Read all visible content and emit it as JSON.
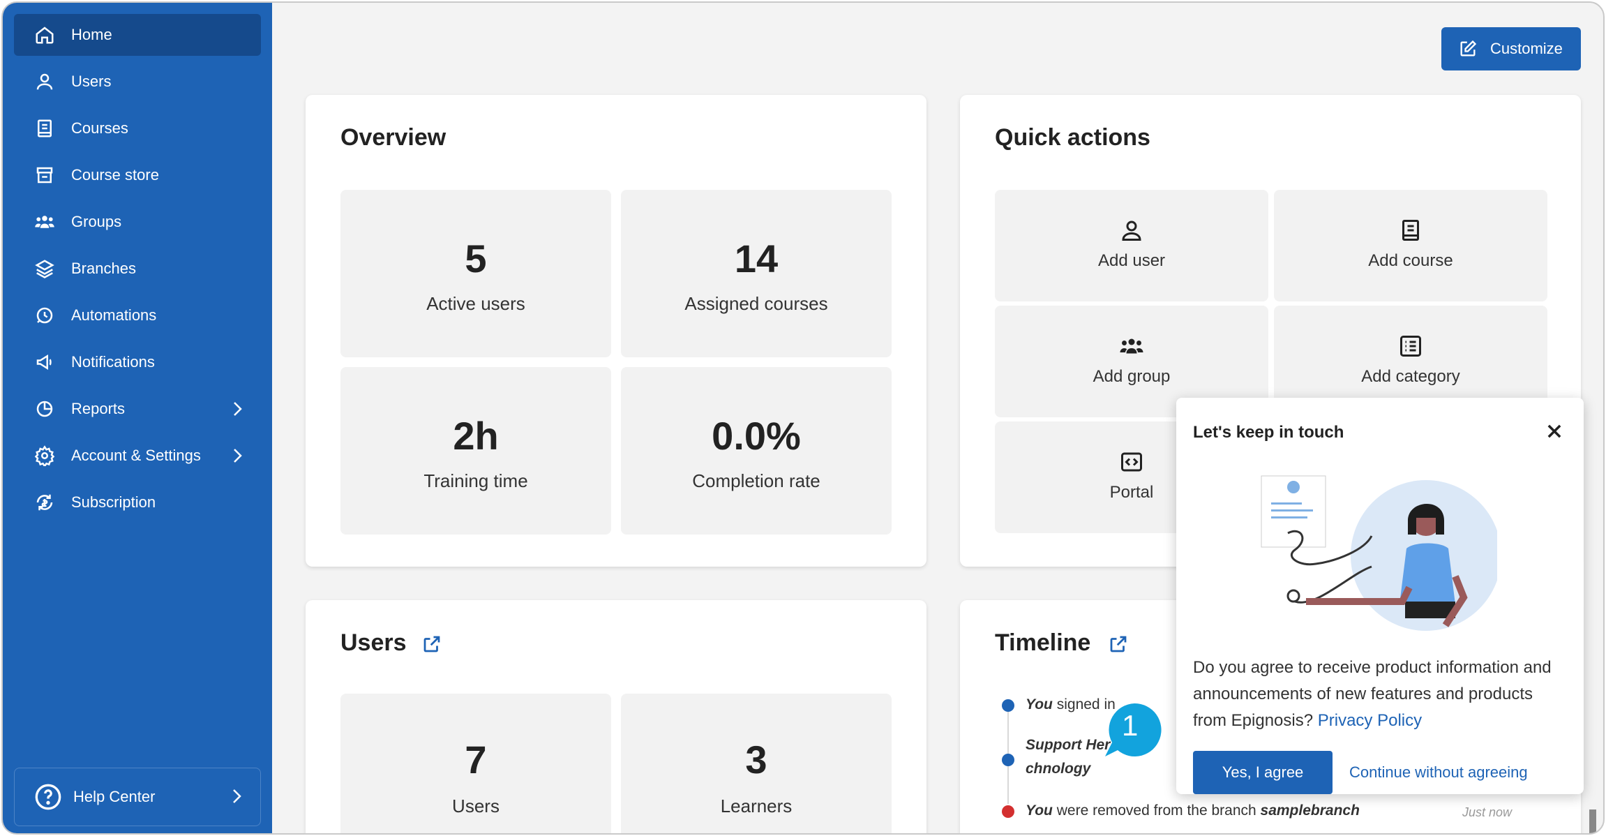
{
  "sidebar": {
    "items": [
      {
        "label": "Home",
        "icon": "home-icon"
      },
      {
        "label": "Users",
        "icon": "user-icon"
      },
      {
        "label": "Courses",
        "icon": "book-icon"
      },
      {
        "label": "Course store",
        "icon": "store-icon"
      },
      {
        "label": "Groups",
        "icon": "group-icon"
      },
      {
        "label": "Branches",
        "icon": "layers-icon"
      },
      {
        "label": "Automations",
        "icon": "automation-icon"
      },
      {
        "label": "Notifications",
        "icon": "megaphone-icon"
      },
      {
        "label": "Reports",
        "icon": "pie-chart-icon"
      },
      {
        "label": "Account & Settings",
        "icon": "gear-icon"
      },
      {
        "label": "Subscription",
        "icon": "subscription-icon"
      }
    ],
    "help_label": "Help Center"
  },
  "header": {
    "customize_label": "Customize"
  },
  "overview": {
    "title": "Overview",
    "stats": [
      {
        "value": "5",
        "caption": "Active users"
      },
      {
        "value": "14",
        "caption": "Assigned courses"
      },
      {
        "value": "2h",
        "caption": "Training time"
      },
      {
        "value": "0.0%",
        "caption": "Completion rate"
      }
    ]
  },
  "quick_actions": {
    "title": "Quick actions",
    "items": [
      {
        "label": "Add user",
        "icon": "user-icon"
      },
      {
        "label": "Add course",
        "icon": "book-icon"
      },
      {
        "label": "Add group",
        "icon": "group-icon"
      },
      {
        "label": "Add category",
        "icon": "list-icon"
      },
      {
        "label": "Portal",
        "icon": "code-icon"
      }
    ]
  },
  "users_card": {
    "title": "Users",
    "stats": [
      {
        "value": "7",
        "caption": "Users"
      },
      {
        "value": "3",
        "caption": "Learners"
      }
    ]
  },
  "timeline": {
    "title": "Timeline",
    "events": [
      {
        "actor": "You",
        "text": " signed in"
      },
      {
        "actor": "Support Her",
        "text": ""
      },
      {
        "actor": "chnology",
        "text": ""
      },
      {
        "actor": "You",
        "text": " were removed from the branch ",
        "object": "samplebranch",
        "time": "Just now"
      }
    ]
  },
  "popup": {
    "title": "Let's keep in touch",
    "body": "Do you agree to receive product information and announcements of new features and products from Epignosis?",
    "link": "Privacy Policy",
    "agree_label": "Yes, I agree",
    "continue_label": "Continue without agreeing"
  },
  "callout": {
    "number": "1"
  },
  "colors": {
    "brand": "#1e63b5",
    "brand_dark": "#154a8c",
    "dot_blue": "#1e63b5",
    "dot_red": "#d32f2f"
  }
}
